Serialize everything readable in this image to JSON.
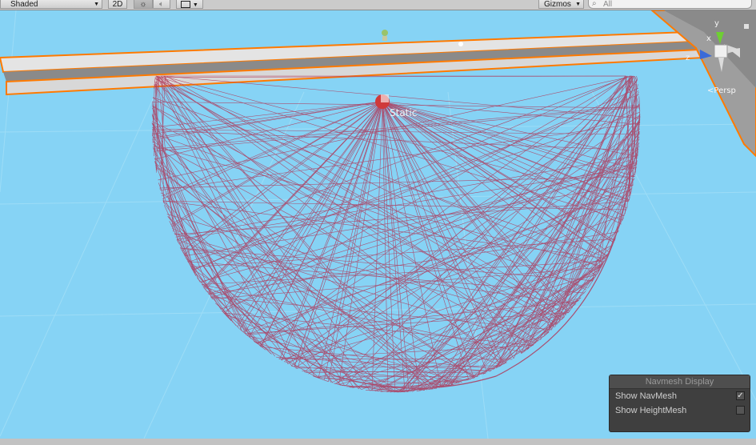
{
  "toolbar": {
    "shading_mode": "Shaded",
    "mode_2d_label": "2D",
    "lighting_icon": "sun-icon",
    "audio_icon": "speaker-icon",
    "effects_icon": "image-icon",
    "gizmos_label": "Gizmos",
    "search_placeholder": "All"
  },
  "scene": {
    "object_label": "Static",
    "projection_label": "Persp",
    "gizmo_axes": [
      "y",
      "x",
      "z"
    ],
    "background_color": "#86d3f5",
    "navmesh_color": "#b0395a",
    "highlight_color": "#ff7a00"
  },
  "navmesh_panel": {
    "title": "Navmesh Display",
    "options": [
      {
        "label": "Show NavMesh",
        "checked": true
      },
      {
        "label": "Show HeightMesh",
        "checked": false
      }
    ]
  }
}
